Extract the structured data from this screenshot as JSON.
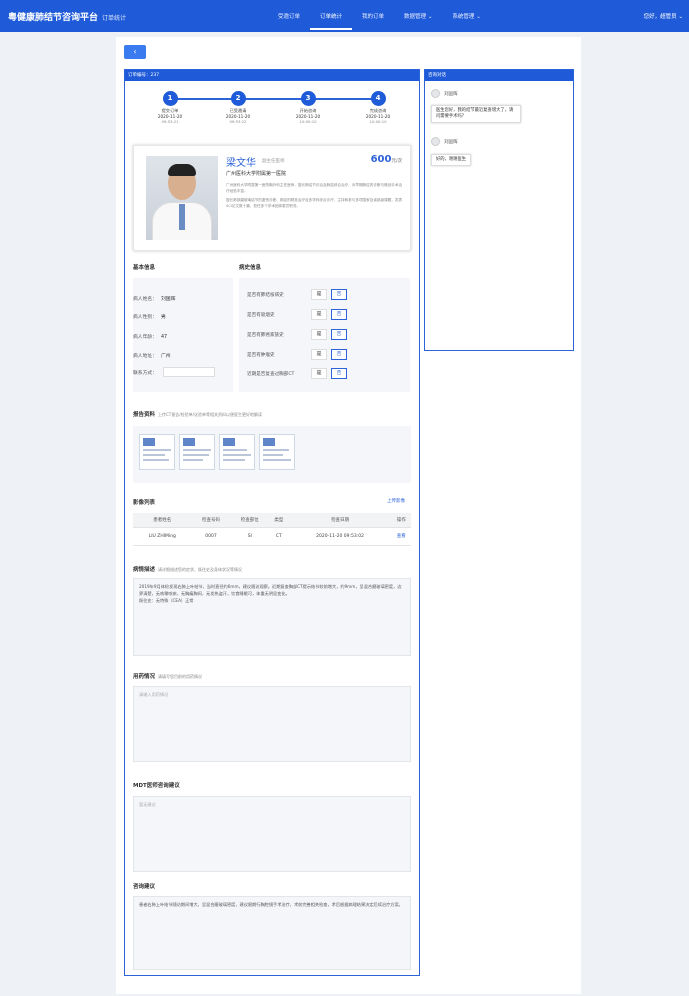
{
  "app": {
    "title": "粤健康肺结节咨询平台",
    "subtitle": "订单统计"
  },
  "nav": [
    "受邀订单",
    "订单统计",
    "我的订单",
    "数据管理",
    "系统管理"
  ],
  "user": "您好，超管员",
  "back_icon": "chevron-left-icon",
  "order": {
    "header": "订单编号：237"
  },
  "steps": [
    {
      "num": "1",
      "label": "提交订单",
      "date": "2020-11-20",
      "time": "09:53:21"
    },
    {
      "num": "2",
      "label": "已受邀请",
      "date": "2020-11-20",
      "time": "09:53:22"
    },
    {
      "num": "3",
      "label": "开始咨询",
      "date": "2020-11-20",
      "time": "10:00:10"
    },
    {
      "num": "4",
      "label": "完成咨询",
      "date": "2020-11-20",
      "time": "10:00:10"
    }
  ],
  "doctor": {
    "name": "梁文华",
    "title": "副主任医师",
    "price": "600",
    "price_unit": "元/次",
    "hospital": "广州医科大学附属第一医院",
    "desc1": "广州医科大学附属第一医院胸外科主任医师，擅长肺结节诊治及肺癌综合治疗，对早期肺癌的诊断与微创手术治疗经验丰富。",
    "desc2": "擅长肺部磨玻璃结节的鉴别诊断、肺癌的精准治疗及多学科综合诊疗，主持和参与多项国家及省部级课题，发表SCI论文数十篇，担任多个学术团体委员职务。"
  },
  "basic": {
    "title": "基本信息",
    "name_label": "病人姓名：",
    "name": "刘国辉",
    "gender_label": "病人性别：",
    "gender": "男",
    "age_label": "病人年龄：",
    "age": "47",
    "address_label": "病人地址：",
    "address": "广州",
    "phone_label": "联系方式："
  },
  "history": {
    "title": "病史信息",
    "items": [
      {
        "q": "是否有肺结核病史",
        "yes": "是",
        "no": "否",
        "selected": "no"
      },
      {
        "q": "是否有吸烟史",
        "yes": "是",
        "no": "否",
        "selected": "no"
      },
      {
        "q": "是否有肺癌家族史",
        "yes": "是",
        "no": "否",
        "selected": "no"
      },
      {
        "q": "是否有肿瘤史",
        "yes": "是",
        "no": "否",
        "selected": "no"
      },
      {
        "q": "近期是否复查过胸部CT",
        "yes": "是",
        "no": "否",
        "selected": "no"
      }
    ]
  },
  "report": {
    "title": "报告资料",
    "hint": "上传CT报告/检验单/化验单等相关资料以便医生更好地解读"
  },
  "images": {
    "title": "影像列表",
    "link": "上传影像",
    "columns": [
      "患者姓名",
      "检查号码",
      "检查部位",
      "类型",
      "检查日期",
      "操作"
    ],
    "rows": [
      {
        "patient": "LIU ZHIMing",
        "number": "0007",
        "part": "SI",
        "type": "CT",
        "date": "2020-11-20 09:53:02",
        "op": "查看"
      }
    ]
  },
  "condition": {
    "title": "病情描述",
    "hint": "请详细描述您的症状、既往史及身体状况等情况",
    "text": "2019年9月体检发现右肺上叶结节，当时直径约6mm，建议随访观察。近期复查胸部CT提示结节较前增大，约9mm，呈混合磨玻璃密度，边界清楚，无咳嗽咳痰，无胸痛胸闷，无发热盗汗，饮食睡眠可，体重无明显变化。",
    "extra": "既往史：无特殊（CEA）正常"
  },
  "medication": {
    "title": "用药情况",
    "hint": "请填写您目前的用药情况",
    "placeholder": "请输入用药情况"
  },
  "mdt": {
    "title": "MDT医师咨询建议",
    "placeholder": "暂无建议"
  },
  "advice": {
    "title": "咨询建议",
    "text": "患者右肺上叶结节随访期间增大，呈混合磨玻璃密度，建议限期行胸腔镜手术治疗，术前完善相关检查，术后根据病理结果决定后续治疗方案。"
  },
  "chat": {
    "header": "咨询对话",
    "messages": [
      {
        "name": "刘国辉",
        "text": "医生您好，我的结节最近复查增大了，请问需要手术吗？"
      },
      {
        "name": "刘国辉",
        "text": "好的，谢谢医生"
      }
    ]
  }
}
